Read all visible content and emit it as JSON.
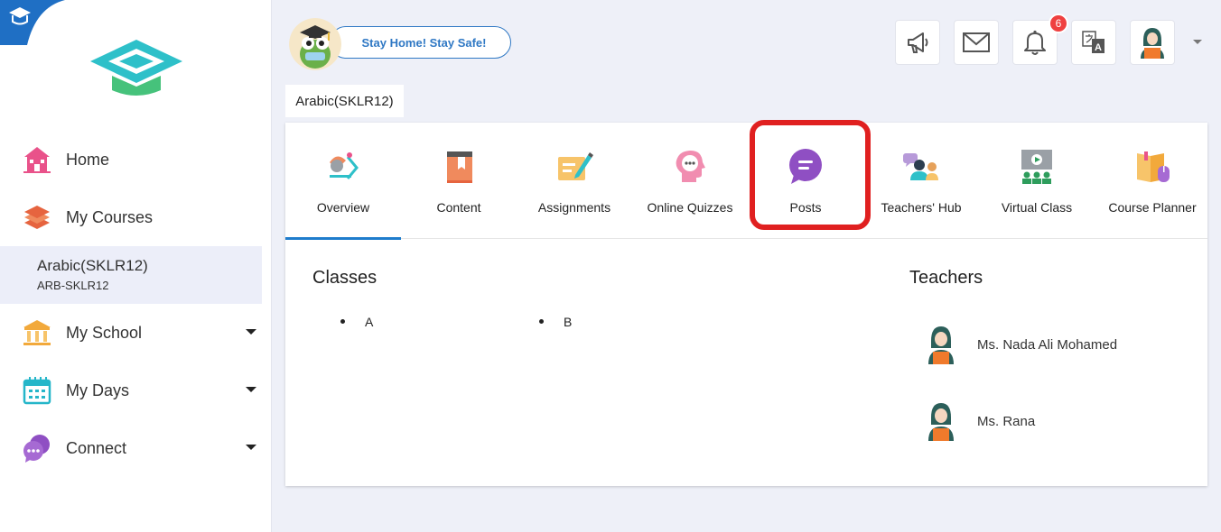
{
  "sidebar": {
    "corner_icon": "school-cap-badge-icon",
    "logo_icon": "graduation-cap-logo-icon",
    "items": [
      {
        "label": "Home",
        "icon": "home-icon"
      },
      {
        "label": "My Courses",
        "icon": "books-stack-icon"
      },
      {
        "label": "My School",
        "icon": "school-building-icon"
      },
      {
        "label": "My Days",
        "icon": "calendar-icon"
      },
      {
        "label": "Connect",
        "icon": "chat-bubbles-icon"
      }
    ],
    "active_course": {
      "name": "Arabic(SKLR12)",
      "code": "ARB-SKLR12"
    }
  },
  "header": {
    "mascot_icon": "frog-graduate-mascot-icon",
    "slogan": "Stay Home! Stay Safe!",
    "buttons": [
      "megaphone-icon",
      "mail-icon",
      "bell-icon",
      "translate-icon",
      "avatar"
    ],
    "notification_count": "6"
  },
  "course_tab": "Arabic(SKLR12)",
  "tabs": [
    {
      "label": "Overview",
      "icon": "overview-icon",
      "active": true
    },
    {
      "label": "Content",
      "icon": "book-icon"
    },
    {
      "label": "Assignments",
      "icon": "assignment-pen-icon"
    },
    {
      "label": "Online Quizzes",
      "icon": "quiz-head-icon"
    },
    {
      "label": "Posts",
      "icon": "posts-chat-icon",
      "highlighted": true
    },
    {
      "label": "Teachers' Hub",
      "icon": "teachers-hub-icon"
    },
    {
      "label": "Virtual Class",
      "icon": "virtual-class-icon"
    },
    {
      "label": "Course Planner",
      "icon": "course-planner-icon"
    }
  ],
  "classes": {
    "heading": "Classes",
    "items": [
      "A",
      "B"
    ]
  },
  "teachers": {
    "heading": "Teachers",
    "items": [
      "Ms. Nada Ali Mohamed",
      "Ms. Rana"
    ]
  },
  "colors": {
    "accent": "#1e7ccc",
    "highlight": "#e02020",
    "badge": "#ef4040"
  }
}
